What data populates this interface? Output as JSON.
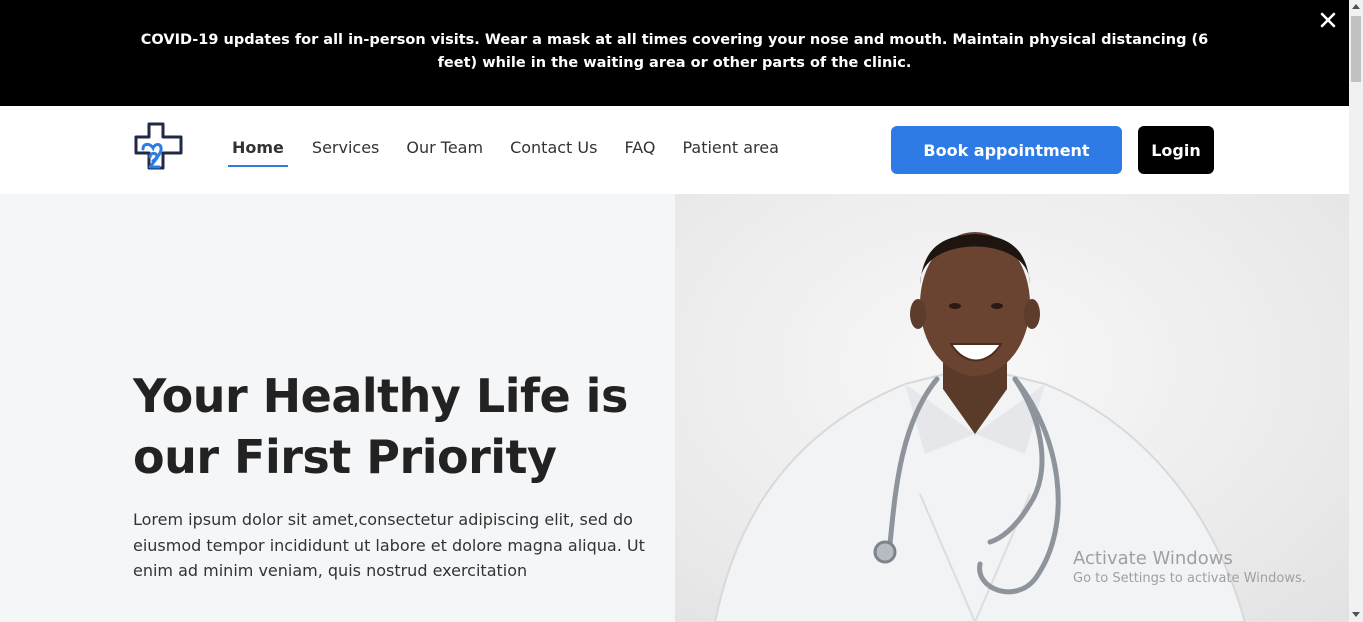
{
  "banner": {
    "text": "COVID-19 updates for all in-person visits. Wear a mask at all times covering your nose and mouth. Maintain physical distancing (6 feet) while in the waiting area or other parts of the clinic.",
    "close_icon": "close-icon"
  },
  "navbar": {
    "logo_icon": "medical-cross-heart-logo",
    "links": [
      "Home",
      "Services",
      "Our Team",
      "Contact Us",
      "FAQ",
      "Patient area"
    ],
    "active_link": "Home",
    "book_label": "Book appointment",
    "login_label": "Login"
  },
  "hero": {
    "title": "Your Healthy Life is our First Priority",
    "description": "Lorem ipsum dolor sit amet,consectetur adipiscing elit, sed do eiusmod tempor incididunt ut labore et dolore magna aliqua. Ut enim ad minim veniam, quis nostrud exercitation"
  },
  "watermark": {
    "title": "Activate Windows",
    "subtitle": "Go to Settings to activate Windows."
  },
  "colors": {
    "accent": "#2f7be5",
    "banner_bg": "#000000",
    "hero_bg": "#f5f6f8",
    "heading": "#222222"
  }
}
